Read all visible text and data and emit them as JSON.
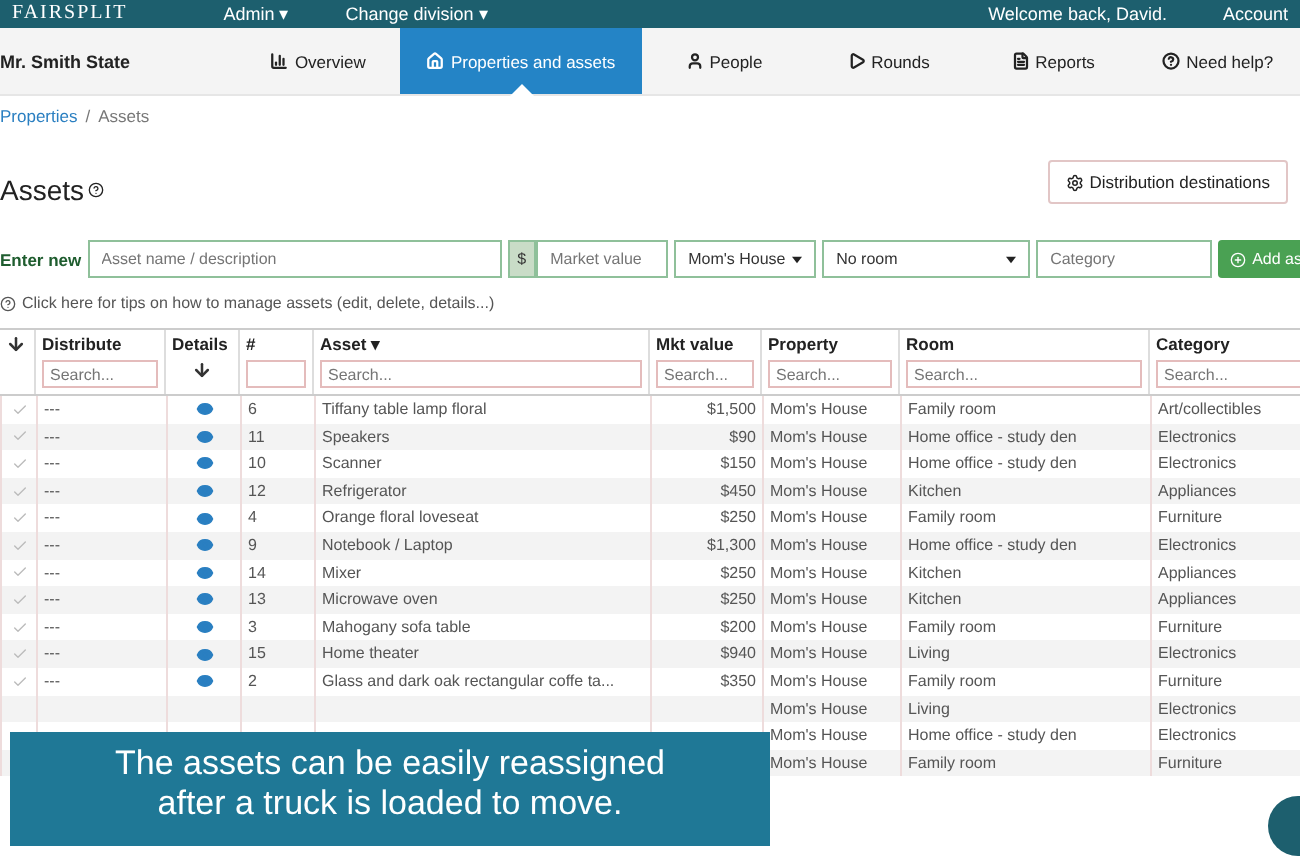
{
  "topbar": {
    "logo": "FAIRSPLIT",
    "menus": [
      "Admin ▾",
      "Change division ▾"
    ],
    "welcome": "Welcome back, David.",
    "account": "Account"
  },
  "nav": {
    "estate": "Mr. Smith State",
    "tabs": [
      {
        "kind": "chart",
        "label": "Overview",
        "selected": false
      },
      {
        "kind": "home",
        "label": "Properties and assets",
        "selected": true
      },
      {
        "kind": "user",
        "label": "People",
        "selected": false
      },
      {
        "kind": "play",
        "label": "Rounds",
        "selected": false
      },
      {
        "kind": "file",
        "label": "Reports",
        "selected": false
      },
      {
        "kind": "help",
        "label": "Need help?",
        "selected": false
      }
    ]
  },
  "breadcrumb": {
    "items": [
      "Properties",
      "Assets"
    ],
    "separator": "/"
  },
  "title": "Assets",
  "distribution_button": "Distribution destinations",
  "enter_new": {
    "label": "Enter new",
    "name_placeholder": "Asset name / description",
    "currency": "$",
    "value_placeholder": "Market value",
    "property": "Mom's House",
    "room": "No room",
    "category_placeholder": "Category",
    "add_button": "Add as"
  },
  "tips": "Click here for tips on how to manage assets (edit, delete, details...)",
  "table": {
    "columns": [
      {
        "label": "Distribute",
        "placeholder": "Search..."
      },
      {
        "label": "Details"
      },
      {
        "label": "#"
      },
      {
        "label": "Asset ▾",
        "placeholder": "Search..."
      },
      {
        "label": "Mkt value",
        "placeholder": "Search..."
      },
      {
        "label": "Property",
        "placeholder": "Search..."
      },
      {
        "label": "Room",
        "placeholder": "Search..."
      },
      {
        "label": "Category",
        "placeholder": "Search..."
      }
    ],
    "rows": [
      {
        "distribute": "---",
        "number": "6",
        "asset": "Tiffany table lamp floral",
        "value": "$1,500",
        "property": "Mom's House",
        "room": "Family room",
        "category": "Art/collectibles"
      },
      {
        "distribute": "---",
        "number": "11",
        "asset": "Speakers",
        "value": "$90",
        "property": "Mom's House",
        "room": "Home office - study den",
        "category": "Electronics"
      },
      {
        "distribute": "---",
        "number": "10",
        "asset": "Scanner",
        "value": "$150",
        "property": "Mom's House",
        "room": "Home office - study den",
        "category": "Electronics"
      },
      {
        "distribute": "---",
        "number": "12",
        "asset": "Refrigerator",
        "value": "$450",
        "property": "Mom's House",
        "room": "Kitchen",
        "category": "Appliances"
      },
      {
        "distribute": "---",
        "number": "4",
        "asset": "Orange floral loveseat",
        "value": "$250",
        "property": "Mom's House",
        "room": "Family room",
        "category": "Furniture"
      },
      {
        "distribute": "---",
        "number": "9",
        "asset": "Notebook / Laptop",
        "value": "$1,300",
        "property": "Mom's House",
        "room": "Home office - study den",
        "category": "Electronics"
      },
      {
        "distribute": "---",
        "number": "14",
        "asset": "Mixer",
        "value": "$250",
        "property": "Mom's House",
        "room": "Kitchen",
        "category": "Appliances"
      },
      {
        "distribute": "---",
        "number": "13",
        "asset": "Microwave oven",
        "value": "$250",
        "property": "Mom's House",
        "room": "Kitchen",
        "category": "Appliances"
      },
      {
        "distribute": "---",
        "number": "3",
        "asset": "Mahogany sofa table",
        "value": "$200",
        "property": "Mom's House",
        "room": "Family room",
        "category": "Furniture"
      },
      {
        "distribute": "---",
        "number": "15",
        "asset": "Home theater",
        "value": "$940",
        "property": "Mom's House",
        "room": "Living",
        "category": "Electronics"
      },
      {
        "distribute": "---",
        "number": "2",
        "asset": "Glass and dark oak rectangular coffe ta...",
        "value": "$350",
        "property": "Mom's House",
        "room": "Family room",
        "category": "Furniture"
      },
      {
        "property": "Mom's House",
        "room": "Living",
        "category": "Electronics"
      },
      {
        "property": "Mom's House",
        "room": "Home office - study den",
        "category": "Electronics"
      },
      {
        "property": "Mom's House",
        "room": "Family room",
        "category": "Furniture"
      }
    ]
  },
  "caption": [
    "The assets can be easily reassigned",
    "after a truck is loaded to move."
  ]
}
